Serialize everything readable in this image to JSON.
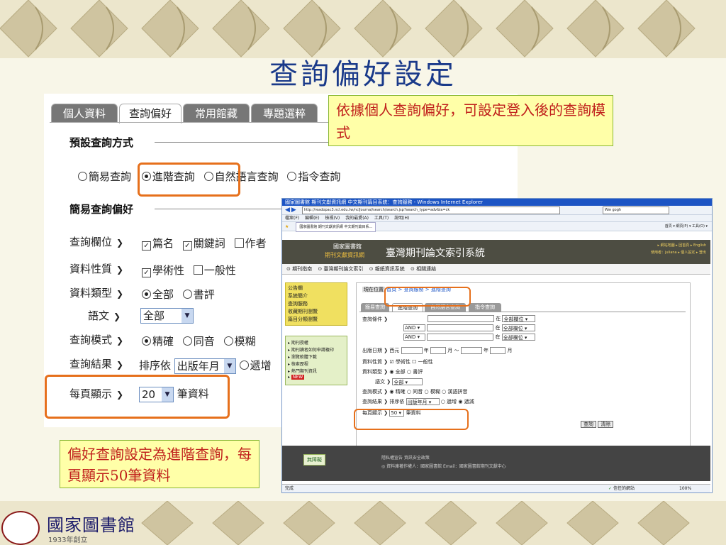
{
  "slide": {
    "title": "查詢偏好設定",
    "callout_top": "依據個人查詢偏好，可設定登入後的查詢模式",
    "callout_bottom": "偏好查詢設定為進階查詢，每頁顯示50筆資料"
  },
  "settings": {
    "tabs": [
      "個人資料",
      "查詢偏好",
      "常用館藏",
      "專題選粹"
    ],
    "active_tab": "查詢偏好",
    "section_default": "預設查詢方式",
    "default_options": [
      "簡易查詢",
      "進階查詢",
      "自然語言查詢",
      "指令查詢"
    ],
    "default_selected": "進階查詢",
    "section_simple": "簡易查詢偏好",
    "fields": {
      "label": "查詢欄位",
      "options": [
        {
          "text": "篇名",
          "checked": true
        },
        {
          "text": "關鍵詞",
          "checked": true
        },
        {
          "text": "作者",
          "checked": false
        }
      ]
    },
    "nature": {
      "label": "資料性質",
      "options": [
        {
          "text": "學術性",
          "checked": true
        },
        {
          "text": "一般性",
          "checked": false
        }
      ]
    },
    "type": {
      "label": "資料類型",
      "options": [
        "全部",
        "書評"
      ],
      "selected": "全部"
    },
    "language": {
      "label": "語文",
      "value": "全部"
    },
    "mode": {
      "label": "查詢模式",
      "options": [
        "精確",
        "同音",
        "模糊"
      ],
      "selected": "精確"
    },
    "result": {
      "label": "查詢結果",
      "prefix": "排序依",
      "value": "出版年月",
      "suffix": "遞增"
    },
    "perpage": {
      "label": "每頁顯示",
      "value": "20",
      "suffix": "筆資料"
    }
  },
  "browser": {
    "window_title": "國家圖書館 期刊文獻資訊網 中文期刊篇目系統：查詢服務 - Windows Internet Explorer",
    "address": "http://readopac3.ncl.edu.tw/nclJournal/search/search.jsp?search_type=adv&la=ck",
    "search_box": "Ww gogh",
    "menu": [
      "檔案(F)",
      "編輯(E)",
      "檢視(V)",
      "我的最愛(A)",
      "工具(T)",
      "說明(H)"
    ],
    "tab_label": "國家圖書館 期刊文獻資訊網 中文期刊篇目系...",
    "toolbar_right": "首頁 ▾ 網頁(P) ▾ 工具(O) ▾",
    "banner": {
      "org": "國家圖書館",
      "org_sub": "期刊文獻資訊網",
      "system": "臺灣期刊論文索引系統",
      "links": "▸ 網站地圖  ▸ 回首頁  ▸ English",
      "user": "使用者：juliana  ▸ 個人設定  ▸ 登出"
    },
    "nav": [
      "期刊指南",
      "臺灣期刊論文索引",
      "報紙資訊系統",
      "相關連結"
    ],
    "side_menu": [
      "公告欄",
      "系統簡介",
      "查詢服務",
      "收藏期刊瀏覽",
      "篇目分類瀏覽"
    ],
    "side_links": [
      "期刊授權",
      "期刊讀者如何申請複印",
      "瀏覽軟體下載",
      "檢索歷程",
      "熱門期刊資訊"
    ],
    "side_new": "NEW",
    "location": "現在位置",
    "breadcrumb": "首頁 > 查詢服務 > 進階查詢",
    "tabs": [
      "簡易查詢",
      "進階查詢",
      "自然語言查詢",
      "指令查詢"
    ],
    "form": {
      "cond_label": "查詢條件",
      "in_word": "在",
      "field_value": "全部欄位",
      "bool_value": "AND",
      "date_label": "出版日期",
      "date_era": "西元",
      "year": "年",
      "month": "月",
      "to": "～",
      "nature_label": "資料性質",
      "nature_opts": [
        "學術性",
        "一般性"
      ],
      "type_label": "資料類型",
      "type_opts": [
        "全部",
        "書評"
      ],
      "lang_label": "語文",
      "lang_value": "全部",
      "mode_label": "查詢模式",
      "mode_opts": [
        "精確",
        "同音",
        "模糊",
        "漢語拼音"
      ],
      "result_label": "查詢結果",
      "result_prefix": "排序依",
      "result_value": "出版年月",
      "result_opts": [
        "遞增",
        "遞減"
      ],
      "perpage_label": "每頁顯示",
      "perpage_value": "50",
      "perpage_suffix": "筆資料",
      "search_btn": "查詢",
      "clear_btn": "清除"
    },
    "footer_badge": "無障礙",
    "footer_links": "隱私權宣告    資訊安全政策",
    "footer_copy": "◎ 資料庫著作權人：國家圖書館    Email：國家圖書館期刊文獻中心",
    "status_left": "完成",
    "status_zone": "信任的網站",
    "status_zoom": "100%"
  },
  "logo": {
    "name": "國家圖書館",
    "year": "1933年創立"
  },
  "colors": {
    "title": "#1a3a8a",
    "callout_text": "#c0201c",
    "highlight": "#e6701c",
    "callout_bg": "#ffffa8"
  }
}
